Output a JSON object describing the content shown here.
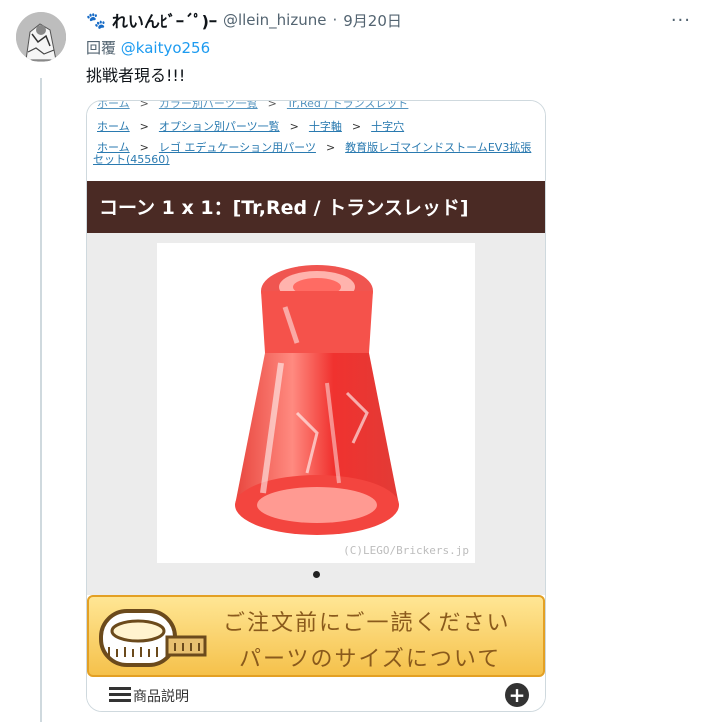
{
  "tweet": {
    "display_name": "れいんﾋﾞｰ´ﾟ)ｰ",
    "paw": "🐾",
    "handle": "@llein_hizune",
    "separator": "·",
    "date": "9月20日",
    "more": "···",
    "reply_prefix": "回覆",
    "reply_mention": "@kaityo256",
    "text": "挑戦者現る!!!"
  },
  "card": {
    "breadcrumbs": {
      "row0": [
        "ホーム",
        "カラー別パーツ一覧",
        "Tr,Red / トランスレッド"
      ],
      "row1": [
        "ホーム",
        "オプション別パーツ一覧",
        "十字軸",
        "十字穴"
      ],
      "row2": [
        "ホーム",
        "レゴ エデュケーション用パーツ",
        "教育版レゴマインドストームEV3拡張"
      ],
      "row3": "セット(45560)",
      "sep": ">"
    },
    "title": "コーン 1 x 1：[Tr,Red / トランスレッド]",
    "watermark": "(C)LEGO/Brickers.jp",
    "banner_line1": "ご注文前にご一読ください",
    "banner_line2": "パーツのサイズについて",
    "desc_label": "商品説明",
    "plus": "+"
  },
  "icons": {
    "more": "more-icon",
    "menu": "menu-icon",
    "plus": "plus-circle-icon",
    "tape": "measuring-tape-icon"
  },
  "colors": {
    "link": "#1d9bf0",
    "title_bar": "#4a2a24",
    "banner": "#f5c14b",
    "brick": "#ef2a2a"
  }
}
